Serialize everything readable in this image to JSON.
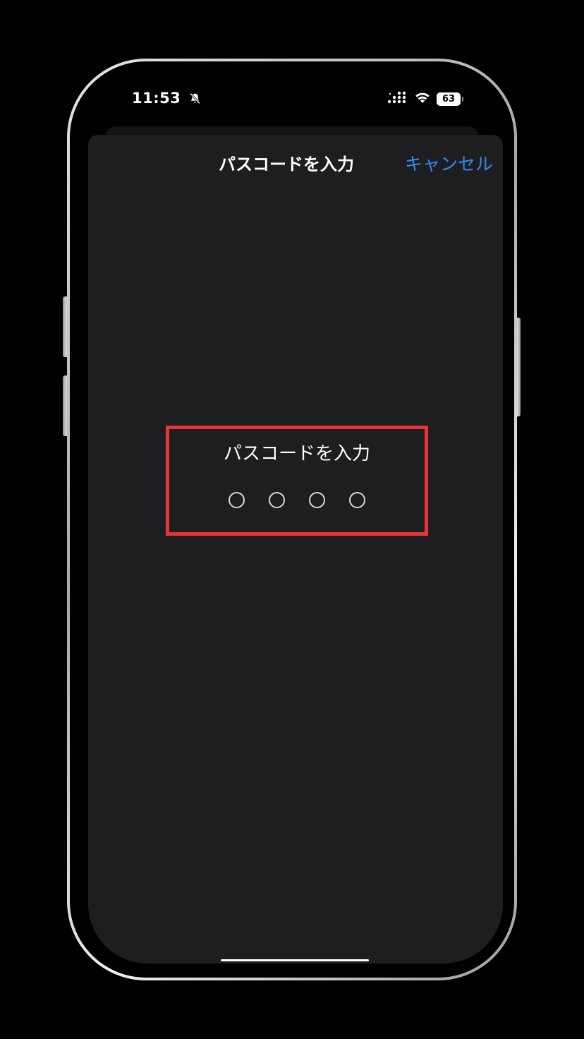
{
  "status_bar": {
    "time": "11:53",
    "battery": "63",
    "icons": [
      "bell-slash-icon",
      "cellular-signal-icon",
      "wifi-icon",
      "battery-icon"
    ]
  },
  "nav": {
    "title": "パスコードを入力",
    "cancel_label": "キャンセル"
  },
  "passcode": {
    "prompt": "パスコードを入力",
    "digits_total": 4,
    "digits_entered": 0
  },
  "colors": {
    "accent": "#2f8cf0",
    "highlight_box": "#ea3239",
    "sheet_background": "#1e1e21"
  }
}
